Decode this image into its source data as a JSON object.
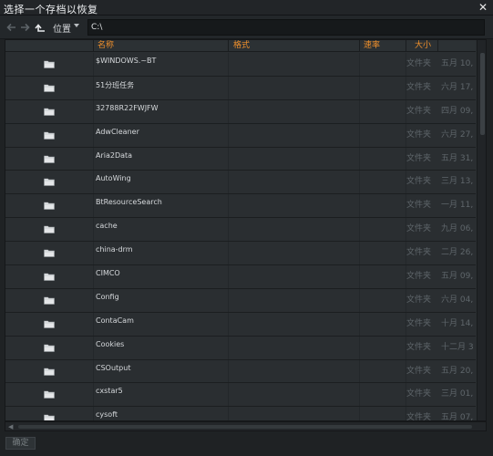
{
  "window": {
    "title": "选择一个存档以恢复"
  },
  "toolbar": {
    "location_label": "位置",
    "path_value": "C:\\"
  },
  "columns": {
    "name": "名称",
    "format": "格式",
    "speed": "速率",
    "size": "大小"
  },
  "rows": [
    {
      "name": "$WINDOWS.~BT",
      "type": "文件夹",
      "date": "五月 10,"
    },
    {
      "name": "51分班任务",
      "type": "文件夹",
      "date": "六月 17,"
    },
    {
      "name": "32788R22FWJFW",
      "type": "文件夹",
      "date": "四月 09,"
    },
    {
      "name": "AdwCleaner",
      "type": "文件夹",
      "date": "六月 27,"
    },
    {
      "name": "Aria2Data",
      "type": "文件夹",
      "date": "五月 31,"
    },
    {
      "name": "AutoWing",
      "type": "文件夹",
      "date": "三月 13,"
    },
    {
      "name": "BtResourceSearch",
      "type": "文件夹",
      "date": "一月 11,"
    },
    {
      "name": "cache",
      "type": "文件夹",
      "date": "九月 06,"
    },
    {
      "name": "china-drm",
      "type": "文件夹",
      "date": "二月 26,"
    },
    {
      "name": "CIMCO",
      "type": "文件夹",
      "date": "五月 09,"
    },
    {
      "name": "Config",
      "type": "文件夹",
      "date": "六月 04,"
    },
    {
      "name": "ContaCam",
      "type": "文件夹",
      "date": "十月 14,"
    },
    {
      "name": "Cookies",
      "type": "文件夹",
      "date": "十二月 3"
    },
    {
      "name": "CSOutput",
      "type": "文件夹",
      "date": "五月 20,"
    },
    {
      "name": "cxstar5",
      "type": "文件夹",
      "date": "三月 01,"
    },
    {
      "name": "cysoft",
      "type": "文件夹",
      "date": "五月 07,"
    }
  ],
  "footer": {
    "ok_label": "确定"
  },
  "colors": {
    "accent": "#f0902c",
    "background": "#2a2e31",
    "muted_text": "#5f666b"
  },
  "icons": {
    "close": "close-icon",
    "back": "arrow-left-icon",
    "forward": "arrow-right-icon",
    "up": "folder-up-icon",
    "folder": "folder-icon"
  }
}
